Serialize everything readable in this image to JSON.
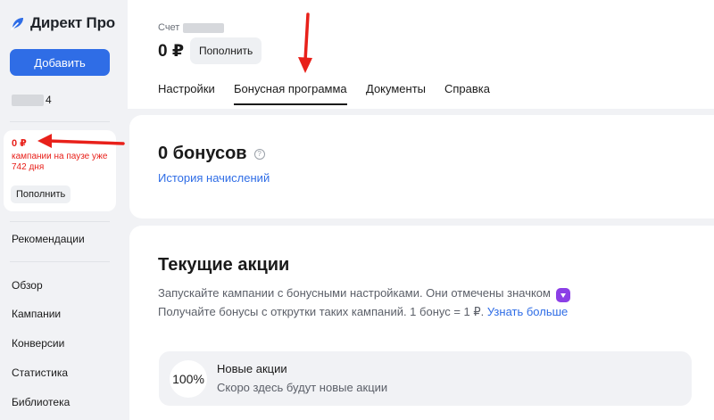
{
  "brand": {
    "name": "Директ Про"
  },
  "sidebar": {
    "add_label": "Добавить",
    "account_suffix": "4",
    "balance": {
      "amount": "0 ₽",
      "status": "кампании на паузе уже 742 дня",
      "topup_label": "Пополнить"
    },
    "nav": [
      "Рекомендации",
      "Обзор",
      "Кампании",
      "Конверсии",
      "Статистика",
      "Библиотека"
    ]
  },
  "header": {
    "account_label": "Счет",
    "amount": "0 ₽",
    "topup_label": "Пополнить",
    "tabs": [
      {
        "label": "Настройки",
        "active": false
      },
      {
        "label": "Бонусная программа",
        "active": true
      },
      {
        "label": "Документы",
        "active": false
      },
      {
        "label": "Справка",
        "active": false
      }
    ]
  },
  "bonus": {
    "title": "0 бонусов",
    "help_icon": "question-circle-icon",
    "history_link": "История начислений"
  },
  "promotions": {
    "title": "Текущие акции",
    "desc_line1": "Запускайте кампании с бонусными настройками. Они отмечены значком",
    "desc_line2": "Получайте бонусы с открутки таких кампаний. 1 бонус = 1 ₽.",
    "learn_more": "Узнать больше",
    "new": {
      "percent": "100%",
      "title": "Новые акции",
      "subtitle": "Скоро здесь будут новые акции"
    }
  },
  "colors": {
    "accent": "#2f6de6",
    "alert": "#e8201a",
    "badge": "#8b3fe6"
  }
}
